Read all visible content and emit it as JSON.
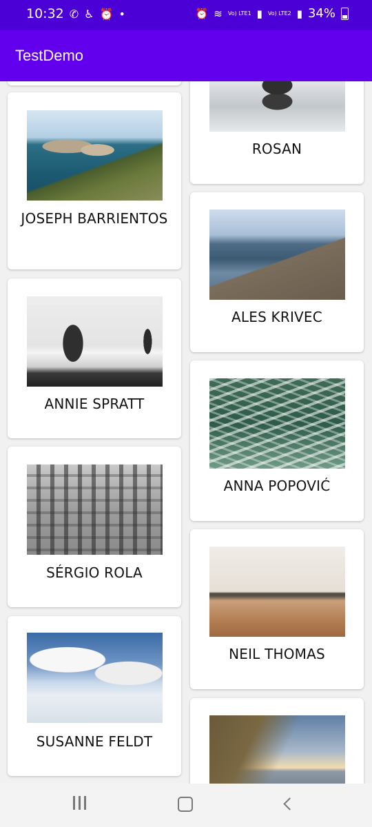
{
  "status_bar": {
    "time": "10:32",
    "left_icons": [
      "whatsapp-icon",
      "accessibility-icon",
      "alarm-icon",
      "dot-icon"
    ],
    "volte1": "Vo) LTE1",
    "volte2": "Vo) LTE2",
    "battery": "34%"
  },
  "app_bar": {
    "title": "TestDemo"
  },
  "cards": {
    "left": [
      {
        "name": "JOSEPH BARRIENTOS",
        "photo": "rocky-coast-photo"
      },
      {
        "name": "ANNIE SPRATT",
        "photo": "sea-stacks-photo"
      },
      {
        "name": "SÉRGIO ROLA",
        "photo": "weathered-building-photo"
      },
      {
        "name": "SUSANNE FELDT",
        "photo": "cloud-reflection-photo"
      }
    ],
    "right": [
      {
        "name": "ROSAN",
        "photo": "rock-reflection-photo"
      },
      {
        "name": "ALES KRIVEC",
        "photo": "lake-pier-photo"
      },
      {
        "name": "ANNA POPOVIĆ",
        "photo": "ocean-waves-photo"
      },
      {
        "name": "NEIL THOMAS",
        "photo": "beach-sunset-photo"
      },
      {
        "name": "",
        "photo": "coastal-cliffs-photo"
      }
    ]
  },
  "nav_bar": {
    "buttons": [
      "recent-apps",
      "home",
      "back"
    ]
  }
}
